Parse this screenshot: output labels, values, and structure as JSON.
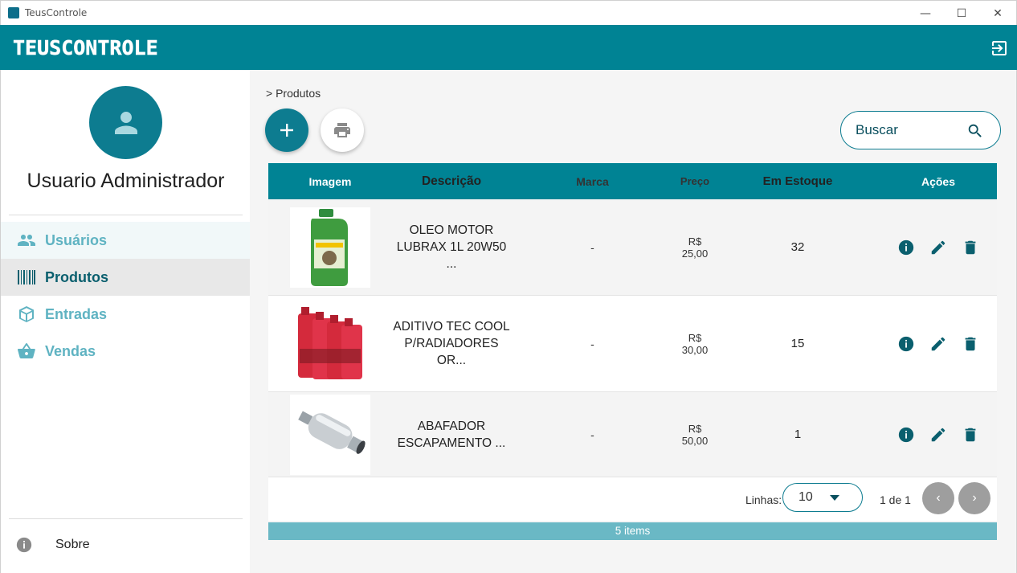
{
  "window": {
    "title": "TeusControle"
  },
  "header": {
    "logo_text": "TEUSCONTROLE"
  },
  "sidebar": {
    "username": "Usuario Administrador",
    "items": [
      {
        "label": "Usuários",
        "icon": "users-icon"
      },
      {
        "label": "Produtos",
        "icon": "barcode-icon"
      },
      {
        "label": "Entradas",
        "icon": "box-icon"
      },
      {
        "label": "Vendas",
        "icon": "basket-icon"
      }
    ],
    "about_label": "Sobre"
  },
  "main": {
    "breadcrumb": "> Produtos",
    "search_placeholder": "Buscar",
    "table": {
      "headers": [
        "Imagem",
        "Descrição",
        "Marca",
        "Preço",
        "Em Estoque",
        "Ações"
      ],
      "rows": [
        {
          "descricao": "OLEO MOTOR LUBRAX 1L 20W50 ...",
          "marca": "-",
          "preco": "R$ 25,00",
          "estoque": "32",
          "image": "oil-bottle"
        },
        {
          "descricao": "ADITIVO TEC COOL P/RADIADORES OR...",
          "marca": "-",
          "preco": "R$ 30,00",
          "estoque": "15",
          "image": "coolant-bottles"
        },
        {
          "descricao": "ABAFADOR ESCAPAMENTO ...",
          "marca": "-",
          "preco": "R$ 50,00",
          "estoque": "1",
          "image": "muffler"
        }
      ]
    },
    "paginator": {
      "rows_label": "Linhas:",
      "rows_value": "10",
      "page_info": "1 de 1"
    },
    "footer": "5 items"
  },
  "colors": {
    "primary": "#008394",
    "accent_light": "#5fb3c2",
    "footer": "#6ab8c5"
  }
}
